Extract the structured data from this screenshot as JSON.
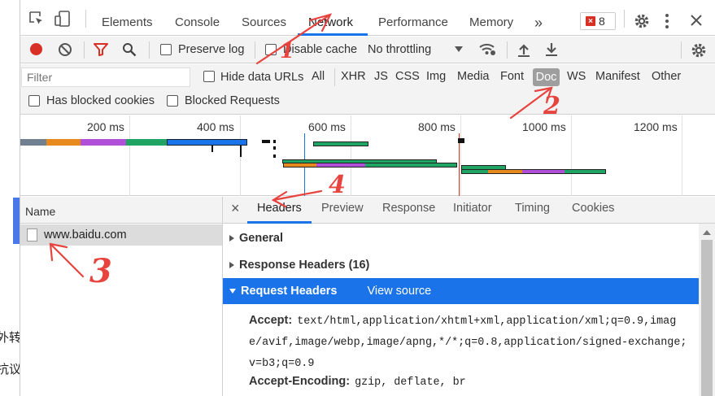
{
  "tabs": [
    {
      "label": "Elements"
    },
    {
      "label": "Console"
    },
    {
      "label": "Sources"
    },
    {
      "label": "Network",
      "active": true
    },
    {
      "label": "Performance"
    },
    {
      "label": "Memory"
    }
  ],
  "more_tabs": "»",
  "error_count": "8",
  "toolbar": {
    "preserve_log": "Preserve log",
    "disable_cache": "Disable cache",
    "throttling": "No throttling"
  },
  "filter": {
    "placeholder": "Filter",
    "hide_data_urls": "Hide data URLs",
    "types": [
      "All",
      "XHR",
      "JS",
      "CSS",
      "Img",
      "Media",
      "Font",
      "Doc",
      "WS",
      "Manifest",
      "Other"
    ],
    "selected_type": "Doc",
    "blocked_cookies": "Has blocked cookies",
    "blocked_requests": "Blocked Requests"
  },
  "timeline": {
    "ticks": [
      "200 ms",
      "400 ms",
      "600 ms",
      "800 ms",
      "1000 ms",
      "1200 ms"
    ]
  },
  "request_list": {
    "header": "Name",
    "items": [
      {
        "name": "www.baidu.com"
      }
    ]
  },
  "details": {
    "close": "×",
    "tabs": [
      "Headers",
      "Preview",
      "Response",
      "Initiator",
      "Timing",
      "Cookies"
    ],
    "active_tab": "Headers",
    "sections": {
      "general": "General",
      "response_headers": "Response Headers (16)",
      "request_headers": "Request Headers",
      "view_source": "View source"
    },
    "headers": [
      {
        "name": "Accept:",
        "lines": [
          "text/html,application/xhtml+xml,application/xml;q=0.9,imag",
          "e/avif,image/webp,image/apng,*/*;q=0.8,application/signed-exchange;",
          "v=b3;q=0.9"
        ]
      },
      {
        "name": "Accept-Encoding:",
        "lines": [
          "gzip, deflate, br"
        ]
      }
    ]
  },
  "page_left_text": [
    "外转",
    "抗议"
  ],
  "annotations": [
    "1",
    "2",
    "3",
    "4"
  ],
  "colors": {
    "accent": "#1a73e8",
    "selected_section": "#1a73e8",
    "record": "#d93025",
    "annotation": "#e8443f"
  }
}
